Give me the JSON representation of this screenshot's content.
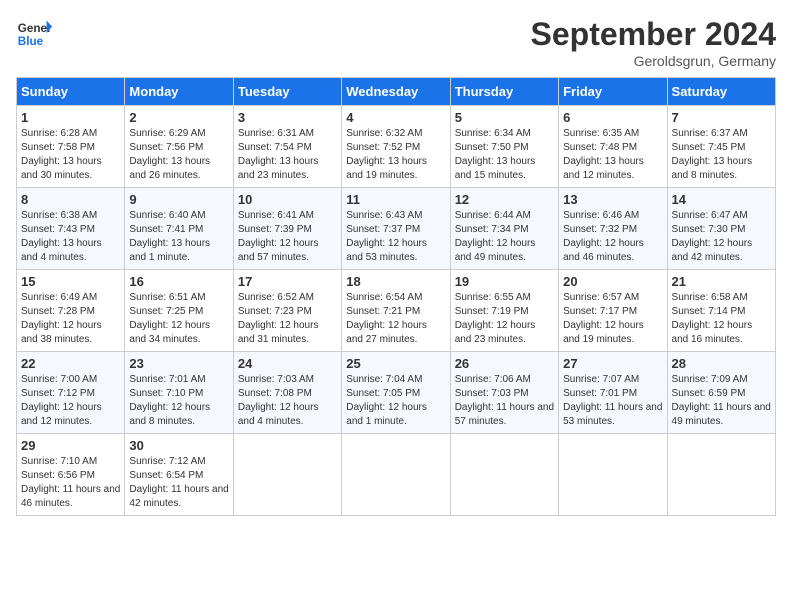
{
  "header": {
    "logo_line1": "General",
    "logo_line2": "Blue",
    "month_title": "September 2024",
    "location": "Geroldsgrun, Germany"
  },
  "weekdays": [
    "Sunday",
    "Monday",
    "Tuesday",
    "Wednesday",
    "Thursday",
    "Friday",
    "Saturday"
  ],
  "weeks": [
    [
      {
        "date": "1",
        "sunrise": "Sunrise: 6:28 AM",
        "sunset": "Sunset: 7:58 PM",
        "daylight": "Daylight: 13 hours and 30 minutes."
      },
      {
        "date": "2",
        "sunrise": "Sunrise: 6:29 AM",
        "sunset": "Sunset: 7:56 PM",
        "daylight": "Daylight: 13 hours and 26 minutes."
      },
      {
        "date": "3",
        "sunrise": "Sunrise: 6:31 AM",
        "sunset": "Sunset: 7:54 PM",
        "daylight": "Daylight: 13 hours and 23 minutes."
      },
      {
        "date": "4",
        "sunrise": "Sunrise: 6:32 AM",
        "sunset": "Sunset: 7:52 PM",
        "daylight": "Daylight: 13 hours and 19 minutes."
      },
      {
        "date": "5",
        "sunrise": "Sunrise: 6:34 AM",
        "sunset": "Sunset: 7:50 PM",
        "daylight": "Daylight: 13 hours and 15 minutes."
      },
      {
        "date": "6",
        "sunrise": "Sunrise: 6:35 AM",
        "sunset": "Sunset: 7:48 PM",
        "daylight": "Daylight: 13 hours and 12 minutes."
      },
      {
        "date": "7",
        "sunrise": "Sunrise: 6:37 AM",
        "sunset": "Sunset: 7:45 PM",
        "daylight": "Daylight: 13 hours and 8 minutes."
      }
    ],
    [
      {
        "date": "8",
        "sunrise": "Sunrise: 6:38 AM",
        "sunset": "Sunset: 7:43 PM",
        "daylight": "Daylight: 13 hours and 4 minutes."
      },
      {
        "date": "9",
        "sunrise": "Sunrise: 6:40 AM",
        "sunset": "Sunset: 7:41 PM",
        "daylight": "Daylight: 13 hours and 1 minute."
      },
      {
        "date": "10",
        "sunrise": "Sunrise: 6:41 AM",
        "sunset": "Sunset: 7:39 PM",
        "daylight": "Daylight: 12 hours and 57 minutes."
      },
      {
        "date": "11",
        "sunrise": "Sunrise: 6:43 AM",
        "sunset": "Sunset: 7:37 PM",
        "daylight": "Daylight: 12 hours and 53 minutes."
      },
      {
        "date": "12",
        "sunrise": "Sunrise: 6:44 AM",
        "sunset": "Sunset: 7:34 PM",
        "daylight": "Daylight: 12 hours and 49 minutes."
      },
      {
        "date": "13",
        "sunrise": "Sunrise: 6:46 AM",
        "sunset": "Sunset: 7:32 PM",
        "daylight": "Daylight: 12 hours and 46 minutes."
      },
      {
        "date": "14",
        "sunrise": "Sunrise: 6:47 AM",
        "sunset": "Sunset: 7:30 PM",
        "daylight": "Daylight: 12 hours and 42 minutes."
      }
    ],
    [
      {
        "date": "15",
        "sunrise": "Sunrise: 6:49 AM",
        "sunset": "Sunset: 7:28 PM",
        "daylight": "Daylight: 12 hours and 38 minutes."
      },
      {
        "date": "16",
        "sunrise": "Sunrise: 6:51 AM",
        "sunset": "Sunset: 7:25 PM",
        "daylight": "Daylight: 12 hours and 34 minutes."
      },
      {
        "date": "17",
        "sunrise": "Sunrise: 6:52 AM",
        "sunset": "Sunset: 7:23 PM",
        "daylight": "Daylight: 12 hours and 31 minutes."
      },
      {
        "date": "18",
        "sunrise": "Sunrise: 6:54 AM",
        "sunset": "Sunset: 7:21 PM",
        "daylight": "Daylight: 12 hours and 27 minutes."
      },
      {
        "date": "19",
        "sunrise": "Sunrise: 6:55 AM",
        "sunset": "Sunset: 7:19 PM",
        "daylight": "Daylight: 12 hours and 23 minutes."
      },
      {
        "date": "20",
        "sunrise": "Sunrise: 6:57 AM",
        "sunset": "Sunset: 7:17 PM",
        "daylight": "Daylight: 12 hours and 19 minutes."
      },
      {
        "date": "21",
        "sunrise": "Sunrise: 6:58 AM",
        "sunset": "Sunset: 7:14 PM",
        "daylight": "Daylight: 12 hours and 16 minutes."
      }
    ],
    [
      {
        "date": "22",
        "sunrise": "Sunrise: 7:00 AM",
        "sunset": "Sunset: 7:12 PM",
        "daylight": "Daylight: 12 hours and 12 minutes."
      },
      {
        "date": "23",
        "sunrise": "Sunrise: 7:01 AM",
        "sunset": "Sunset: 7:10 PM",
        "daylight": "Daylight: 12 hours and 8 minutes."
      },
      {
        "date": "24",
        "sunrise": "Sunrise: 7:03 AM",
        "sunset": "Sunset: 7:08 PM",
        "daylight": "Daylight: 12 hours and 4 minutes."
      },
      {
        "date": "25",
        "sunrise": "Sunrise: 7:04 AM",
        "sunset": "Sunset: 7:05 PM",
        "daylight": "Daylight: 12 hours and 1 minute."
      },
      {
        "date": "26",
        "sunrise": "Sunrise: 7:06 AM",
        "sunset": "Sunset: 7:03 PM",
        "daylight": "Daylight: 11 hours and 57 minutes."
      },
      {
        "date": "27",
        "sunrise": "Sunrise: 7:07 AM",
        "sunset": "Sunset: 7:01 PM",
        "daylight": "Daylight: 11 hours and 53 minutes."
      },
      {
        "date": "28",
        "sunrise": "Sunrise: 7:09 AM",
        "sunset": "Sunset: 6:59 PM",
        "daylight": "Daylight: 11 hours and 49 minutes."
      }
    ],
    [
      {
        "date": "29",
        "sunrise": "Sunrise: 7:10 AM",
        "sunset": "Sunset: 6:56 PM",
        "daylight": "Daylight: 11 hours and 46 minutes."
      },
      {
        "date": "30",
        "sunrise": "Sunrise: 7:12 AM",
        "sunset": "Sunset: 6:54 PM",
        "daylight": "Daylight: 11 hours and 42 minutes."
      },
      null,
      null,
      null,
      null,
      null
    ]
  ]
}
